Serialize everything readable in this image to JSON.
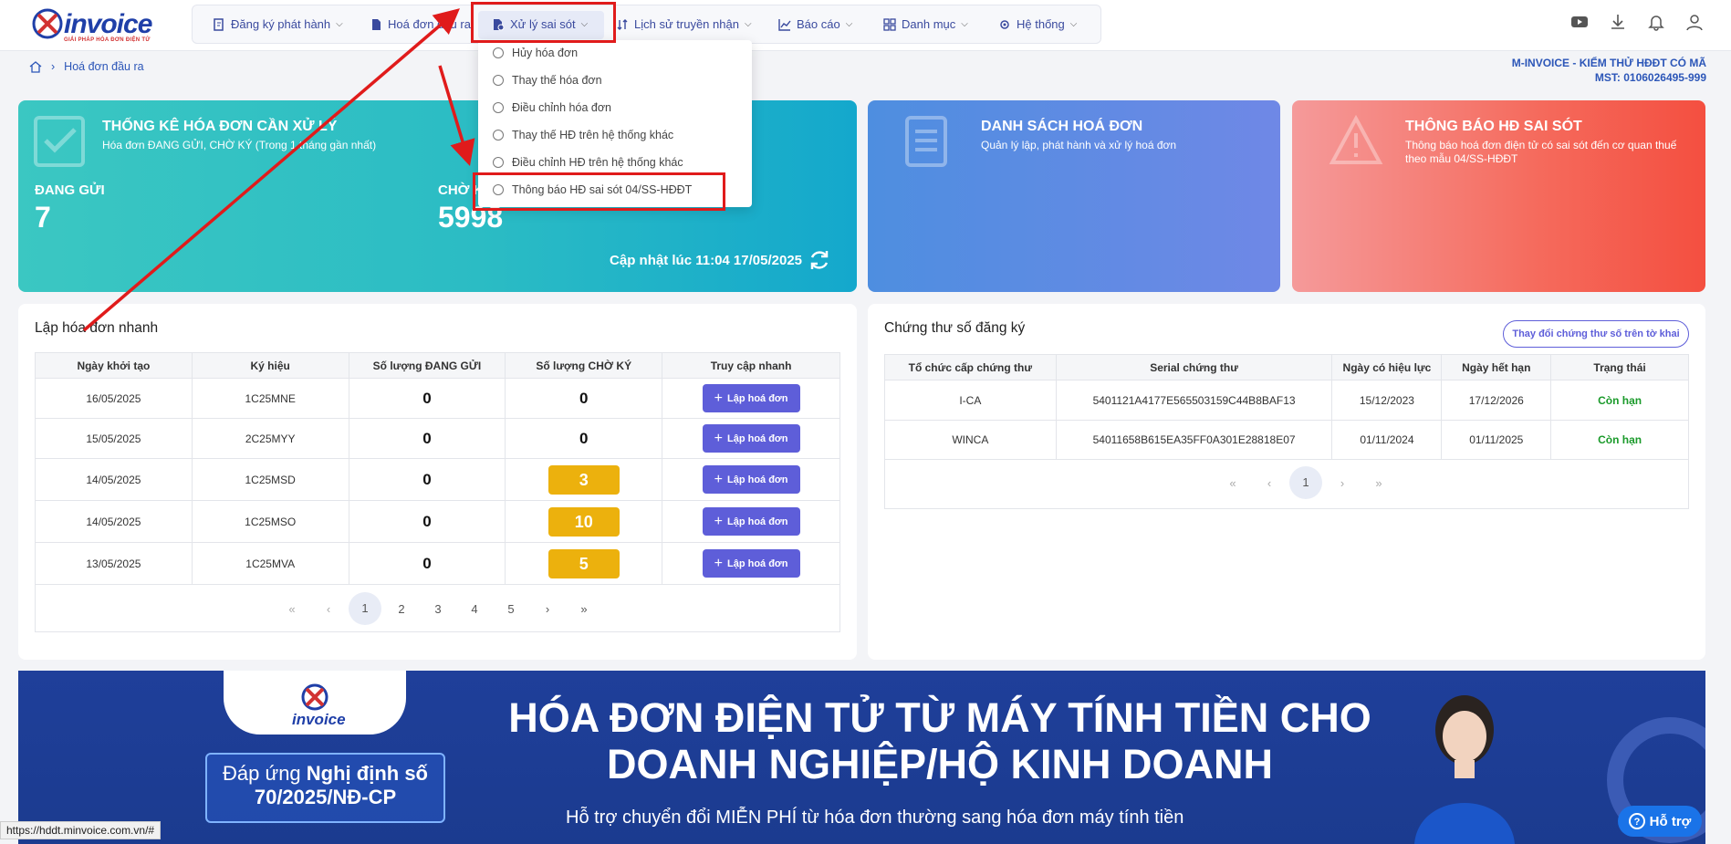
{
  "logo": {
    "text": "invoice",
    "tagline": "GIẢI PHÁP HÓA ĐƠN ĐIỆN TỬ"
  },
  "nav": [
    {
      "label": "Đăng ký phát hành",
      "icon": "doc-edit-icon"
    },
    {
      "label": "Hoá đơn đầu ra",
      "icon": "invoice-icon"
    },
    {
      "label": "Xử lý sai sót",
      "icon": "error-doc-icon"
    },
    {
      "label": "Lịch sử truyền nhận",
      "icon": "sort-arrows-icon"
    },
    {
      "label": "Báo cáo",
      "icon": "chart-icon"
    },
    {
      "label": "Danh mục",
      "icon": "grid-icon"
    },
    {
      "label": "Hệ thống",
      "icon": "gear-icon"
    }
  ],
  "dropdown": [
    "Hủy hóa đơn",
    "Thay thế hóa đơn",
    "Điều chỉnh hóa đơn",
    "Thay thế HĐ trên hệ thống khác",
    "Điều chỉnh HĐ trên hệ thống khác",
    "Thông báo HĐ sai sót 04/SS-HĐĐT"
  ],
  "breadcrumb": {
    "current": "Hoá đơn đầu ra"
  },
  "company": {
    "name": "M-INVOICE - KIỂM THỬ HĐĐT CÓ MÃ",
    "tax": "MST: 0106026495-999"
  },
  "cards": {
    "stats": {
      "title": "THỐNG KÊ HÓA ĐƠN CẦN XỬ LÝ",
      "subtitle": "Hóa đơn ĐANG GỬI, CHỜ KÝ (Trong 1 tháng gần nhất)",
      "sending_label": "ĐANG GỬI",
      "sending_value": "7",
      "pending_label": "CHỜ KÝ",
      "pending_value": "5998",
      "updated": "Cập nhật lúc 11:04 17/05/2025"
    },
    "list": {
      "title": "DANH SÁCH HOÁ ĐƠN",
      "subtitle": "Quản lý lập, phát hành và xử lý hoá đơn"
    },
    "error": {
      "title": "THÔNG BÁO HĐ SAI SÓT",
      "subtitle": "Thông báo hoá đơn điện tử có sai sót đến cơ quan thuế theo mẫu 04/SS-HĐĐT"
    }
  },
  "quick": {
    "title": "Lập hóa đơn nhanh",
    "headers": [
      "Ngày khởi tạo",
      "Ký hiệu",
      "Số lượng ĐANG GỬI",
      "Số lượng CHỜ KÝ",
      "Truy cập nhanh"
    ],
    "button_label": "Lập hoá đơn",
    "rows": [
      {
        "date": "16/05/2025",
        "symbol": "1C25MNE",
        "sending": "0",
        "pending": "0",
        "highlight": false
      },
      {
        "date": "15/05/2025",
        "symbol": "2C25MYY",
        "sending": "0",
        "pending": "0",
        "highlight": false
      },
      {
        "date": "14/05/2025",
        "symbol": "1C25MSD",
        "sending": "0",
        "pending": "3",
        "highlight": true
      },
      {
        "date": "14/05/2025",
        "symbol": "1C25MSO",
        "sending": "0",
        "pending": "10",
        "highlight": true
      },
      {
        "date": "13/05/2025",
        "symbol": "1C25MVA",
        "sending": "0",
        "pending": "5",
        "highlight": true
      }
    ],
    "pages": [
      "1",
      "2",
      "3",
      "4",
      "5"
    ]
  },
  "certs": {
    "title": "Chứng thư số đăng ký",
    "change_label": "Thay đổi chứng thư số trên tờ khai",
    "headers": [
      "Tổ chức cấp chứng thư",
      "Serial chứng thư",
      "Ngày có hiệu lực",
      "Ngày hết hạn",
      "Trạng thái"
    ],
    "rows": [
      {
        "org": "I-CA",
        "serial": "5401121A4177E565503159C44B8BAF13",
        "from": "15/12/2023",
        "to": "17/12/2026",
        "status": "Còn hạn"
      },
      {
        "org": "WINCA",
        "serial": "54011658B615EA35FF0A301E28818E07",
        "from": "01/11/2024",
        "to": "01/11/2025",
        "status": "Còn hạn"
      }
    ],
    "pages": [
      "1"
    ]
  },
  "pager_symbols": {
    "first": "«",
    "prev": "‹",
    "next": "›",
    "last": "»"
  },
  "banner": {
    "logo_text": "invoice",
    "box_line1": "Đáp ứng",
    "box_line1_bold": "Nghị định số",
    "box_line2": "70/2025/NĐ-CP",
    "headline1": "HÓA ĐƠN ĐIỆN TỬ TỪ MÁY TÍNH TIỀN CHO",
    "headline2": "DOANH NGHIỆP/HỘ KINH DOANH",
    "sub": "Hỗ trợ chuyển đổi MIỄN PHÍ từ hóa đơn thường sang hóa đơn máy tính tiền"
  },
  "help": {
    "label": "Hỗ trợ"
  },
  "status_url": "https://hddt.minvoice.com.vn/#",
  "colors": {
    "brand": "#1f3fa8",
    "accent": "#5e5ed9",
    "highlight": "#e01b1b",
    "pill": "#ecb10d"
  }
}
